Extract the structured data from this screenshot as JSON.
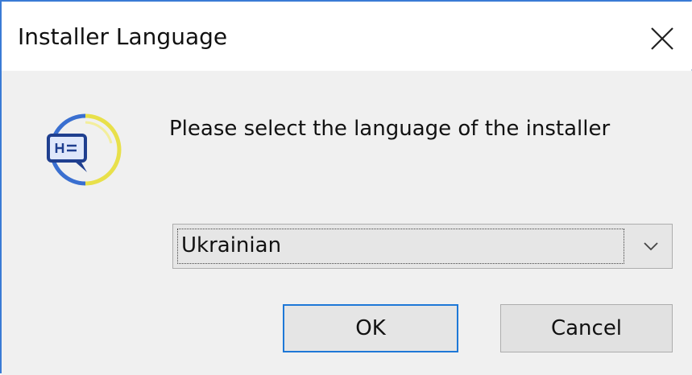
{
  "window": {
    "title": "Installer Language",
    "close_icon": "close-icon",
    "accent_color": "#1e78d7"
  },
  "dialog": {
    "icon": "installer-language-icon",
    "prompt": "Please select the language of the installer",
    "language_select": {
      "selected": "Ukrainian",
      "arrow_icon": "chevron-down-icon"
    },
    "buttons": {
      "ok_label": "OK",
      "cancel_label": "Cancel"
    }
  }
}
